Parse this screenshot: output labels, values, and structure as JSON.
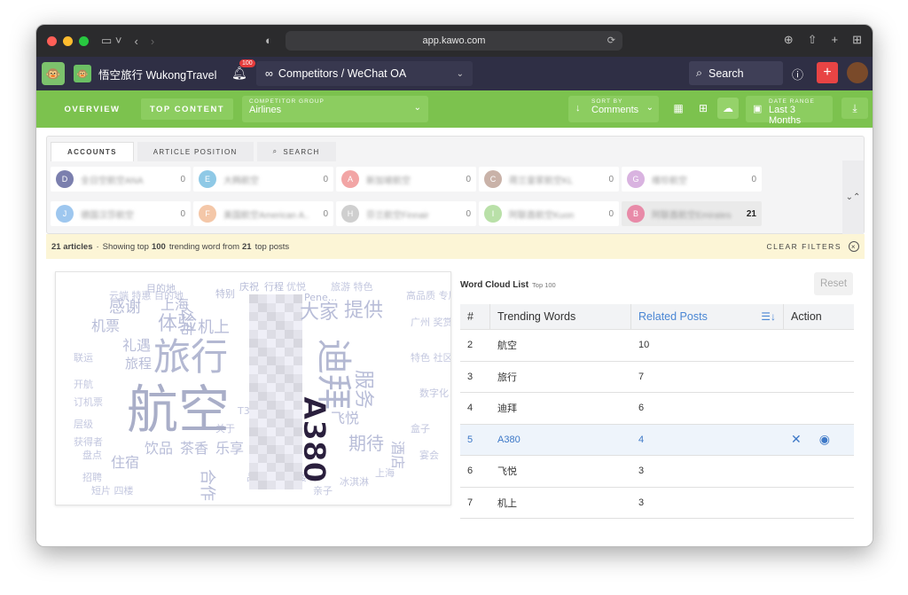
{
  "browser": {
    "url": "app.kawo.com"
  },
  "header": {
    "brand": "悟空旅行 WukongTravel",
    "notif_count": "100",
    "breadcrumb": "Competitors / WeChat OA",
    "search": "Search"
  },
  "toolbar": {
    "tab_overview": "OVERVIEW",
    "tab_top": "TOP CONTENT",
    "group_label": "COMPETITOR GROUP",
    "group_value": "Airlines",
    "sort_label": "SORT BY",
    "sort_value": "Comments",
    "range_label": "DATE RANGE",
    "range_value": "Last 3 Months"
  },
  "panel": {
    "tabs": [
      "ACCOUNTS",
      "ARTICLE POSITION",
      "SEARCH"
    ],
    "accounts": [
      {
        "initial": "D",
        "name": "全日空航空ANA",
        "count": "0",
        "color": "#7b7fae"
      },
      {
        "initial": "E",
        "name": "大韩航空",
        "count": "0",
        "color": "#8fc9e6"
      },
      {
        "initial": "A",
        "name": "新加坡航空",
        "count": "0",
        "color": "#f2a5a5"
      },
      {
        "initial": "C",
        "name": "荷兰皇家航空KL",
        "count": "0",
        "color": "#c9b2a8"
      },
      {
        "initial": "G",
        "name": "维珍航空",
        "count": "0",
        "color": "#d9b3e0"
      },
      {
        "initial": "J",
        "name": "德国汉莎航空",
        "count": "0",
        "color": "#9ec7ef"
      },
      {
        "initial": "F",
        "name": "美国航空American A...",
        "count": "0",
        "color": "#f4c7a8"
      },
      {
        "initial": "H",
        "name": "芬兰航空Finnair",
        "count": "0",
        "color": "#cfcfcf"
      },
      {
        "initial": "I",
        "name": "阿联酋航空Kuon",
        "count": "0",
        "color": "#b9e0a8"
      },
      {
        "initial": "B",
        "name": "阿联酋航空Emirates",
        "count": "21",
        "color": "#e88aa8"
      }
    ]
  },
  "filter": {
    "count": "21 articles",
    "sep": "·",
    "t1": "Showing top",
    "n1": "100",
    "t2": "trending word from",
    "n2": "21",
    "t3": "top posts",
    "clear": "CLEAR FILTERS"
  },
  "wordlist": {
    "title": "Word Cloud List",
    "subtitle": "Top 100",
    "reset": "Reset",
    "headers": {
      "num": "#",
      "word": "Trending Words",
      "related": "Related Posts",
      "action": "Action"
    },
    "rows": [
      {
        "num": "2",
        "word": "航空",
        "related": "10"
      },
      {
        "num": "3",
        "word": "旅行",
        "related": "7"
      },
      {
        "num": "4",
        "word": "迪拜",
        "related": "6"
      },
      {
        "num": "5",
        "word": "A380",
        "related": "4"
      },
      {
        "num": "6",
        "word": "飞悦",
        "related": "3"
      },
      {
        "num": "7",
        "word": "机上",
        "related": "3"
      }
    ]
  },
  "cloud": {
    "words": [
      "航空",
      "旅行",
      "迪拜",
      "A380",
      "体验",
      "提供",
      "大家",
      "感谢",
      "上海",
      "机上",
      "飞悦",
      "服务",
      "期待",
      "酒店",
      "饮品",
      "住宿",
      "目的地",
      "礼遇",
      "机票",
      "旅程",
      "特别",
      "庆祝",
      "行程",
      "公布",
      "合作",
      "茶香",
      "乐享",
      "Pene..."
    ]
  },
  "colors": {
    "green": "#7cc24e",
    "navy": "#2f2f45",
    "accent": "#3d78c7",
    "cloud": "#b8bdd8"
  }
}
